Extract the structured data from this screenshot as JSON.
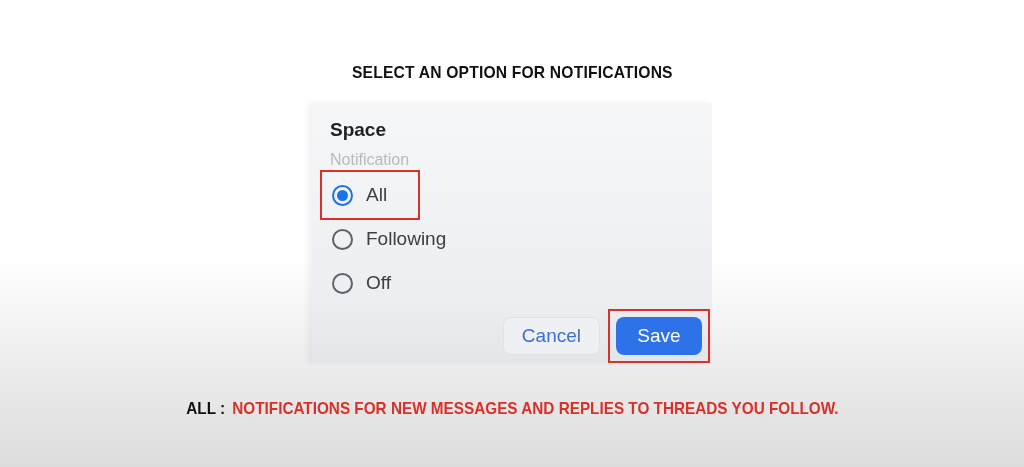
{
  "heading": "SELECT AN OPTION FOR NOTIFICATIONS",
  "dialog": {
    "title": "Space",
    "subtitle": "Notification",
    "options": [
      {
        "label": "All",
        "selected": true,
        "highlighted": true
      },
      {
        "label": "Following",
        "selected": false,
        "highlighted": false
      },
      {
        "label": "Off",
        "selected": false,
        "highlighted": false
      }
    ],
    "buttons": [
      {
        "label": "Cancel",
        "kind": "secondary",
        "highlighted": false
      },
      {
        "label": "Save",
        "kind": "primary",
        "highlighted": true
      }
    ]
  },
  "caption": {
    "term": "ALL :",
    "text": "NOTIFICATIONS FOR NEW MESSAGES AND REPLIES TO THREADS YOU FOLLOW."
  }
}
